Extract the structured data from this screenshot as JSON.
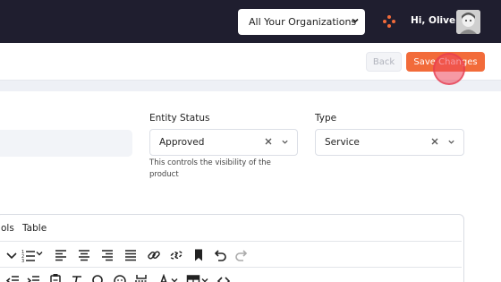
{
  "header": {
    "org_select_value": "All Your Organizations",
    "greeting": "Hi, Oliver"
  },
  "actions": {
    "back_label": "Back",
    "save_label": "Save Changes"
  },
  "form": {
    "entity_status": {
      "label": "Entity Status",
      "value": "Approved",
      "help": "This controls the visibility of the product"
    },
    "type": {
      "label": "Type",
      "value": "Service"
    }
  },
  "editor": {
    "menu_items": [
      "ols",
      "Table"
    ]
  },
  "colors": {
    "topbar": "#1f1e2f",
    "accent": "#f26b3a",
    "click_indicator": "#ee465a"
  }
}
